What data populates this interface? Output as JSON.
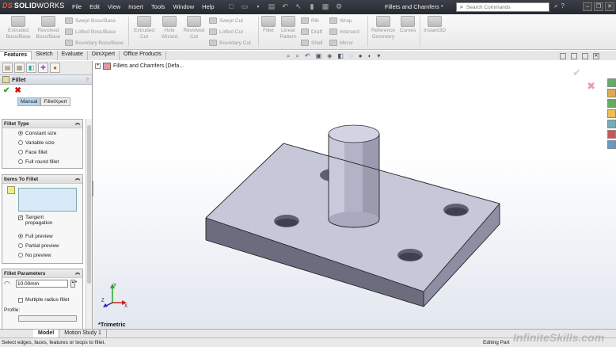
{
  "titlebar": {
    "logo_ds": "DS",
    "logo_solid": "SOLID",
    "logo_works": "WORKS",
    "menus": [
      "File",
      "Edit",
      "View",
      "Insert",
      "Tools",
      "Window",
      "Help"
    ],
    "document_title": "Fillets and Chamfers *",
    "search_placeholder": "Search Commands"
  },
  "command_manager": {
    "extruded_boss": "Extruded Boss/Base",
    "revolved_boss": "Revolved Boss/Base",
    "swept_boss": "Swept Boss/Base",
    "lofted_boss": "Lofted Boss/Base",
    "boundary_boss": "Boundary Boss/Base",
    "extruded_cut": "Extruded Cut",
    "hole_wizard": "Hole Wizard",
    "revolved_cut": "Revolved Cut",
    "swept_cut": "Swept Cut",
    "lofted_cut": "Lofted Cut",
    "boundary_cut": "Boundary Cut",
    "fillet": "Fillet",
    "linear_pattern": "Linear Pattern",
    "rib": "Rib",
    "draft": "Draft",
    "shell": "Shell",
    "wrap": "Wrap",
    "intersect": "Intersect",
    "mirror": "Mirror",
    "reference_geometry": "Reference Geometry",
    "curves": "Curves",
    "instant3d": "Instant3D"
  },
  "tabs": [
    "Features",
    "Sketch",
    "Evaluate",
    "DimXpert",
    "Office Products"
  ],
  "panel": {
    "title": "Fillet",
    "help": "?",
    "mode_manual": "Manual",
    "mode_filletxpert": "FilletXpert",
    "fillet_type": {
      "title": "Fillet Type",
      "options": [
        "Constant size",
        "Variable size",
        "Face fillet",
        "Full round fillet"
      ],
      "selected": "Constant size"
    },
    "items": {
      "title": "Items To Fillet",
      "tangent_propagation": "Tangent propagation",
      "preview_options": [
        "Full preview",
        "Partial preview",
        "No preview"
      ],
      "selected_preview": "Full preview"
    },
    "params": {
      "title": "Fillet Parameters",
      "radius": "10.00mm",
      "multiple_radius": "Multiple radius fillet",
      "profile": "Profile:"
    }
  },
  "viewport": {
    "tree_item": "Fillets and Chamfers  (Defa...",
    "view_label": "*Trimetric",
    "triad_x": "X",
    "triad_y": "Y",
    "triad_z": "Z"
  },
  "bottom_tabs": [
    "Model",
    "Motion Study 1"
  ],
  "status": {
    "message": "Select edges, faces, features or loops to fillet.",
    "mode": "Editing Part"
  },
  "watermark": "InfiniteSkills.com",
  "colors": {
    "model_top": "#c8c9d9",
    "model_front": "#6b6c7e",
    "model_side": "#9a9bad",
    "accept": "#22aa22",
    "cancel": "#cc1111"
  }
}
